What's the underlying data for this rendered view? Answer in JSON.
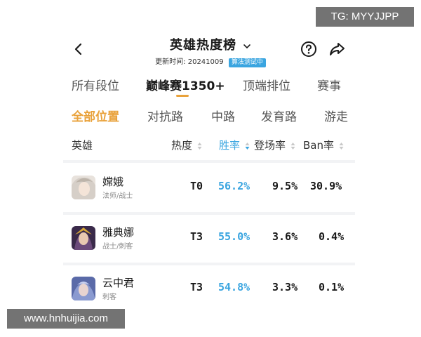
{
  "header": {
    "title": "英雄热度榜",
    "updated_label": "更新时间:",
    "updated_date": "20241009",
    "algo_badge": "算法测试中"
  },
  "tabs": [
    "所有段位",
    "巅峰赛1350+",
    "顶端排位",
    "赛事"
  ],
  "active_tab": "巅峰赛1350+",
  "positions": [
    "全部位置",
    "对抗路",
    "中路",
    "发育路",
    "游走"
  ],
  "active_position": "全部位置",
  "table": {
    "columns": [
      "英雄",
      "热度",
      "胜率",
      "登场率",
      "Ban率"
    ],
    "sorted_column": "胜率",
    "rows": [
      {
        "name": "嫦娥",
        "role": "法师/战士",
        "heat": "T0",
        "win_rate": "56.2%",
        "appearance_rate": "9.5%",
        "ban_rate": "30.9%"
      },
      {
        "name": "雅典娜",
        "role": "战士/刺客",
        "heat": "T3",
        "win_rate": "55.0%",
        "appearance_rate": "3.6%",
        "ban_rate": "0.4%"
      },
      {
        "name": "云中君",
        "role": "刺客",
        "heat": "T3",
        "win_rate": "54.8%",
        "appearance_rate": "3.3%",
        "ban_rate": "0.1%"
      }
    ]
  },
  "watermarks": {
    "top": "TG: MYYJJPP",
    "bottom": "www.hnhuijia.com"
  },
  "colors": {
    "accent_orange": "#e9a23b",
    "accent_blue": "#3aa5e0"
  }
}
